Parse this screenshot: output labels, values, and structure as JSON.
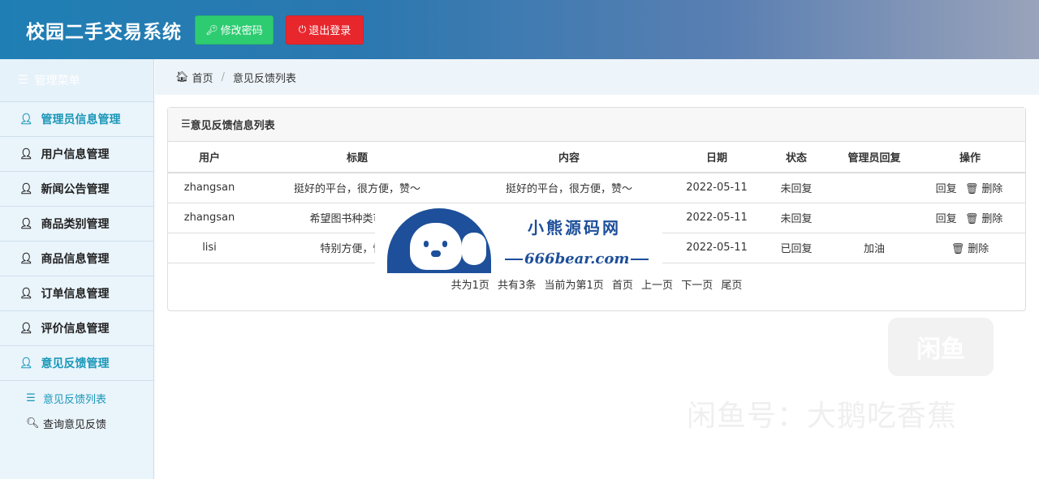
{
  "header": {
    "title": "校园二手交易系统",
    "change_password": "修改密码",
    "logout": "退出登录"
  },
  "sidebar": {
    "title": "管理菜单",
    "items": [
      {
        "label": "管理员信息管理",
        "active": true
      },
      {
        "label": "用户信息管理"
      },
      {
        "label": "新闻公告管理"
      },
      {
        "label": "商品类别管理"
      },
      {
        "label": "商品信息管理"
      },
      {
        "label": "订单信息管理"
      },
      {
        "label": "评价信息管理"
      },
      {
        "label": "意见反馈管理",
        "active": true
      }
    ],
    "subitems": [
      {
        "label": "意见反馈列表",
        "active": true
      },
      {
        "label": "查询意见反馈"
      }
    ]
  },
  "breadcrumb": {
    "home": "首页",
    "current": "意见反馈列表"
  },
  "panel": {
    "title": "意见反馈信息列表",
    "columns": [
      "用户",
      "标题",
      "内容",
      "日期",
      "状态",
      "管理员回复",
      "操作"
    ],
    "rows": [
      {
        "user": "zhangsan",
        "title": "挺好的平台，很方便，赞～",
        "content": "挺好的平台，很方便，赞～",
        "date": "2022-05-11",
        "status": "未回复",
        "reply": "",
        "op_reply": "回复",
        "op_delete": "删除"
      },
      {
        "user": "zhangsan",
        "title": "希望图书种类可以更",
        "content": "",
        "date": "2022-05-11",
        "status": "未回复",
        "reply": "",
        "op_reply": "回复",
        "op_delete": "删除"
      },
      {
        "user": "lisi",
        "title": "特别方便，性价",
        "content": "",
        "date": "2022-05-11",
        "status": "已回复",
        "reply": "加油",
        "op_reply": "",
        "op_delete": "删除"
      }
    ],
    "pager": {
      "total_pages": "共为1页",
      "total_items": "共有3条",
      "current": "当前为第1页",
      "first": "首页",
      "prev": "上一页",
      "next": "下一页",
      "last": "尾页"
    }
  },
  "watermark": {
    "site_name": "小熊源码网",
    "site_url": "666bear.com",
    "app_badge": "闲鱼",
    "account": "闲鱼号：大鹅吃香蕉"
  },
  "colors": {
    "accent": "#1a97b8",
    "green_button": "#2ecc71",
    "red_button": "#e8272d",
    "logo_blue": "#1d4f9a"
  }
}
